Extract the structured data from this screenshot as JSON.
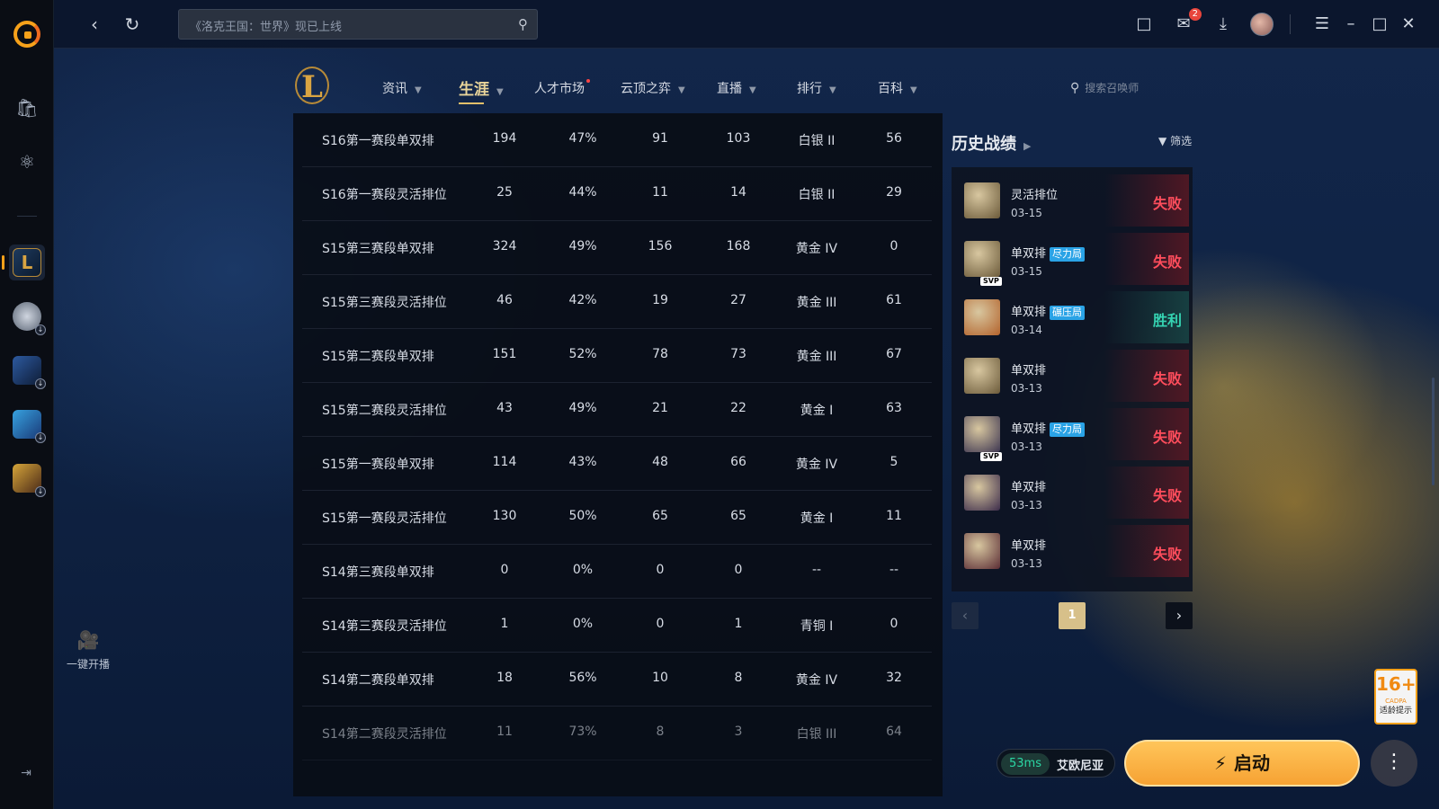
{
  "top": {
    "search_placeholder": "《洛克王国：世界》现已上线",
    "mail_badge": "2"
  },
  "dock": {
    "stream_label": "一键开播"
  },
  "nav": {
    "tabs": [
      {
        "label": "资讯",
        "has_caret": true
      },
      {
        "label": "生涯",
        "has_caret": true,
        "active": true
      },
      {
        "label": "人才市场",
        "has_dot": true
      },
      {
        "label": "云顶之弈",
        "has_caret": true
      },
      {
        "label": "直播",
        "has_caret": true
      },
      {
        "label": "排行",
        "has_caret": true
      },
      {
        "label": "百科",
        "has_caret": true
      }
    ],
    "summoner_search_placeholder": "搜索召唤师"
  },
  "stats": {
    "rows": [
      {
        "season": "S16第一赛段单双排",
        "games": "194",
        "winrate": "47%",
        "wins": "91",
        "losses": "103",
        "rank": "白银 II",
        "points": "56"
      },
      {
        "season": "S16第一赛段灵活排位",
        "games": "25",
        "winrate": "44%",
        "wins": "11",
        "losses": "14",
        "rank": "白银 II",
        "points": "29"
      },
      {
        "season": "S15第三赛段单双排",
        "games": "324",
        "winrate": "49%",
        "wins": "156",
        "losses": "168",
        "rank": "黄金 IV",
        "points": "0"
      },
      {
        "season": "S15第三赛段灵活排位",
        "games": "46",
        "winrate": "42%",
        "wins": "19",
        "losses": "27",
        "rank": "黄金 III",
        "points": "61"
      },
      {
        "season": "S15第二赛段单双排",
        "games": "151",
        "winrate": "52%",
        "wins": "78",
        "losses": "73",
        "rank": "黄金 III",
        "points": "67"
      },
      {
        "season": "S15第二赛段灵活排位",
        "games": "43",
        "winrate": "49%",
        "wins": "21",
        "losses": "22",
        "rank": "黄金 I",
        "points": "63"
      },
      {
        "season": "S15第一赛段单双排",
        "games": "114",
        "winrate": "43%",
        "wins": "48",
        "losses": "66",
        "rank": "黄金 IV",
        "points": "5"
      },
      {
        "season": "S15第一赛段灵活排位",
        "games": "130",
        "winrate": "50%",
        "wins": "65",
        "losses": "65",
        "rank": "黄金 I",
        "points": "11"
      },
      {
        "season": "S14第三赛段单双排",
        "games": "0",
        "winrate": "0%",
        "wins": "0",
        "losses": "0",
        "rank": "--",
        "points": "--"
      },
      {
        "season": "S14第三赛段灵活排位",
        "games": "1",
        "winrate": "0%",
        "wins": "0",
        "losses": "1",
        "rank": "青铜 I",
        "points": "0"
      },
      {
        "season": "S14第二赛段单双排",
        "games": "18",
        "winrate": "56%",
        "wins": "10",
        "losses": "8",
        "rank": "黄金 IV",
        "points": "32"
      },
      {
        "season": "S14第二赛段灵活排位",
        "games": "11",
        "winrate": "73%",
        "wins": "8",
        "losses": "3",
        "rank": "白银 III",
        "points": "64"
      }
    ]
  },
  "history": {
    "title": "历史战绩",
    "filter_label": "筛选",
    "matches": [
      {
        "mode": "灵活排位",
        "tag": "",
        "date": "03-15",
        "result": "失败",
        "outcome": "lose",
        "svp": false,
        "champ_color": "#6b5a3a"
      },
      {
        "mode": "单双排",
        "tag": "尽力局",
        "date": "03-15",
        "result": "失败",
        "outcome": "lose",
        "svp": true,
        "champ_color": "#6b5a3a"
      },
      {
        "mode": "单双排",
        "tag": "碾压局",
        "date": "03-14",
        "result": "胜利",
        "outcome": "win",
        "svp": false,
        "champ_color": "#b3632c"
      },
      {
        "mode": "单双排",
        "tag": "",
        "date": "03-13",
        "result": "失败",
        "outcome": "lose",
        "svp": false,
        "champ_color": "#6b5a3a"
      },
      {
        "mode": "单双排",
        "tag": "尽力局",
        "date": "03-13",
        "result": "失败",
        "outcome": "lose",
        "svp": true,
        "champ_color": "#3c3550"
      },
      {
        "mode": "单双排",
        "tag": "",
        "date": "03-13",
        "result": "失败",
        "outcome": "lose",
        "svp": false,
        "champ_color": "#3b2b4a"
      },
      {
        "mode": "单双排",
        "tag": "",
        "date": "03-13",
        "result": "失败",
        "outcome": "lose",
        "svp": false,
        "champ_color": "#5a2c34"
      }
    ],
    "page": "1"
  },
  "footer": {
    "ping": "53ms",
    "server": "艾欧尼亚",
    "launch_label": "启动",
    "age_rating": "16+",
    "age_org": "CADPA",
    "age_text": "适龄提示"
  },
  "colors": {
    "accent": "#f6a233",
    "lose": "#ff4d5c",
    "win": "#35d3b2",
    "tag": "#2aa3e6"
  }
}
